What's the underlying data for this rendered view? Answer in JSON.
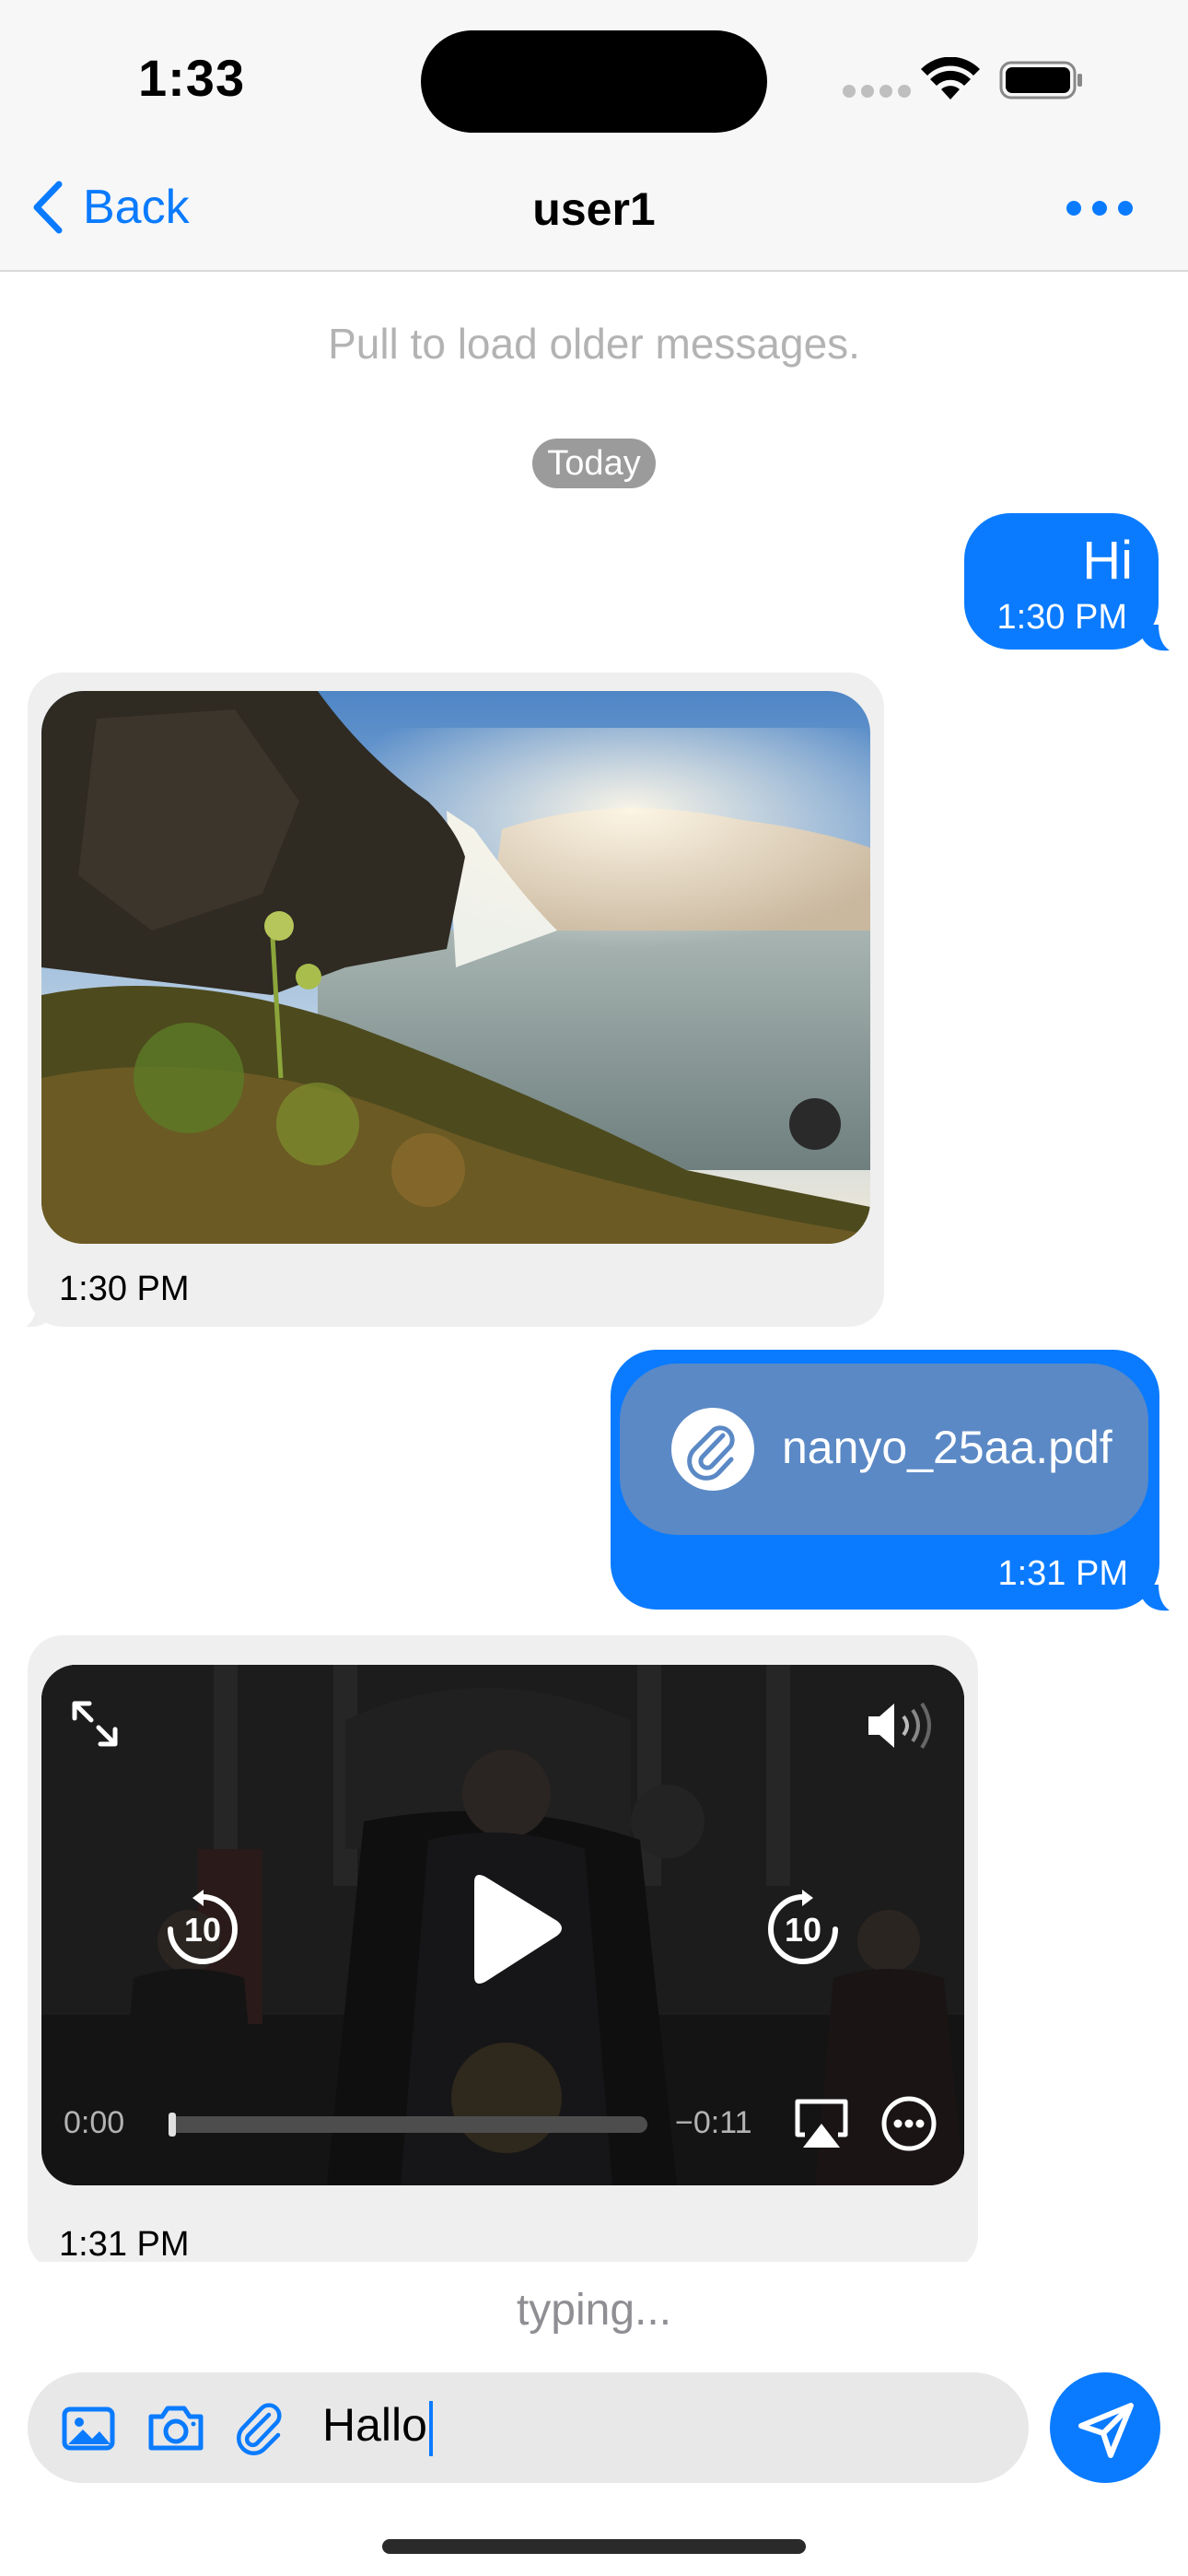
{
  "status_bar": {
    "time": "1:33"
  },
  "nav": {
    "back_label": "Back",
    "title": "user1"
  },
  "messages": {
    "pull_hint": "Pull to load older messages.",
    "date_separator": "Today",
    "items": [
      {
        "direction": "outgoing",
        "type": "text",
        "text": "Hi",
        "time": "1:30 PM"
      },
      {
        "direction": "incoming",
        "type": "image",
        "time": "1:30 PM"
      },
      {
        "direction": "outgoing",
        "type": "file",
        "file_name": "nanyo_25aa.pdf",
        "time": "1:31 PM"
      },
      {
        "direction": "incoming",
        "type": "video",
        "time": "1:31 PM",
        "video": {
          "elapsed": "0:00",
          "remaining": "−0:11",
          "progress": 0.0
        }
      }
    ]
  },
  "typing_indicator": "typing...",
  "composer": {
    "value": "Hallo"
  },
  "colors": {
    "accent": "#0a7bff",
    "incoming_bubble": "#efefef",
    "file_card": "#5b89c6"
  },
  "icons": [
    "chevron-left-icon",
    "more-icon",
    "paperclip-icon",
    "fullscreen-icon",
    "volume-icon",
    "rewind-10-icon",
    "play-icon",
    "forward-10-icon",
    "airplay-icon",
    "options-icon",
    "photo-icon",
    "camera-icon",
    "send-icon"
  ]
}
